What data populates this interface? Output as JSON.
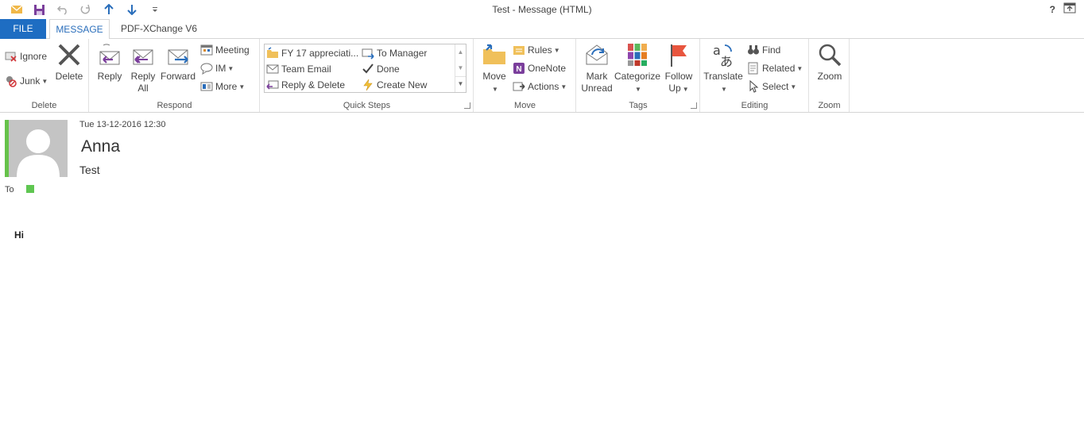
{
  "window": {
    "title": "Test - Message (HTML)",
    "help": "?"
  },
  "tabs": [
    {
      "label": "FILE"
    },
    {
      "label": "MESSAGE"
    },
    {
      "label": "PDF-XChange V6"
    }
  ],
  "ribbon": {
    "delete_group": {
      "label": "Delete",
      "ignore": "Ignore",
      "junk": "Junk",
      "delete": "Delete"
    },
    "respond_group": {
      "label": "Respond",
      "reply": "Reply",
      "reply_all_line1": "Reply",
      "reply_all_line2": "All",
      "forward": "Forward",
      "meeting": "Meeting",
      "im": "IM",
      "more": "More"
    },
    "quick_steps_group": {
      "label": "Quick Steps",
      "items": [
        "FY 17 appreciati...",
        "Team Email",
        "Reply & Delete",
        "To Manager",
        "Done",
        "Create New"
      ]
    },
    "move_group": {
      "label": "Move",
      "move": "Move",
      "rules": "Rules",
      "onenote": "OneNote",
      "actions": "Actions"
    },
    "tags_group": {
      "label": "Tags",
      "mark_unread_line1": "Mark",
      "mark_unread_line2": "Unread",
      "categorize": "Categorize",
      "follow_up_line1": "Follow",
      "follow_up_line2": "Up"
    },
    "editing_group": {
      "label": "Editing",
      "translate": "Translate",
      "find": "Find",
      "related": "Related",
      "select": "Select"
    },
    "zoom_group": {
      "label": "Zoom",
      "zoom": "Zoom"
    }
  },
  "message": {
    "date": "Tue 13-12-2016 12:30",
    "sender": "Anna",
    "subject": "Test",
    "to_label": "To",
    "body": "Hi"
  },
  "colors": {
    "file_tab": "#1e6dc2",
    "accent": "#2a6ebb",
    "presence": "#5fc651"
  }
}
